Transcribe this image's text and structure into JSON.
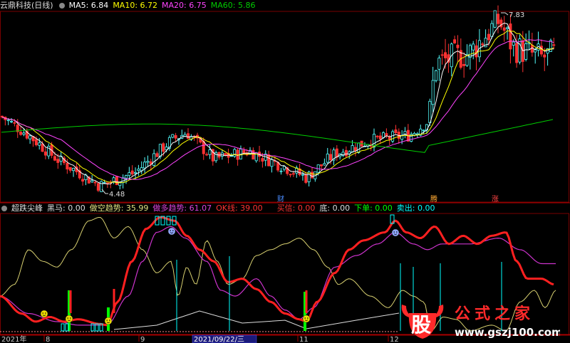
{
  "top_header": {
    "title": "云鼎科技(日线)",
    "ma5": "MA5: 6.84",
    "ma10": "MA10: 6.72",
    "ma20": "MA20: 6.75",
    "ma60": "MA60: 5.86"
  },
  "bottom_header": {
    "name": "超跌尖峰",
    "heima": "黑马: 0.00",
    "kongtrend": "做空趋势: 35.99",
    "duotrend": "做多趋势: 61.07",
    "ok": "OK线: 39.00",
    "buy": "买信: 0.00",
    "di": "底: 0.00",
    "xiadan": "下单: 0.00",
    "sell": "卖出: 0.00"
  },
  "price_labels": {
    "high": "7.83",
    "low": "4.48"
  },
  "event_markers": [
    "财",
    "腾",
    "涨"
  ],
  "x_axis": {
    "labels": [
      "2021年",
      "8",
      "9",
      "2021/09/22/三",
      "11",
      "12"
    ]
  },
  "watermark": {
    "logo_char": "股",
    "brand": "公式之家",
    "url": "www.gszj100.com"
  },
  "colors": {
    "up": "#54ffff",
    "down": "#ff3232",
    "ma5": "#ffffff",
    "ma10": "#ffff00",
    "ma20": "#ff44ff",
    "ma60": "#00cc00",
    "red_line": "#ff2020",
    "violet_line": "#cc33cc",
    "khaki_line": "#d8d070",
    "cyan_bar": "#00ffff",
    "green_bar": "#00ff00",
    "base_line": "#ff8888"
  },
  "chart_data": {
    "type": "line",
    "title": "云鼎科技(日线)",
    "subtitle": "超跌尖峰",
    "price_series": {
      "ma_values": {
        "MA5": 6.84,
        "MA10": 6.72,
        "MA20": 6.75,
        "MA60": 5.86
      },
      "high": 7.83,
      "low": 4.48
    },
    "indicator_values": {
      "黑马": 0.0,
      "做空趋势": 35.99,
      "做多趋势": 61.07,
      "OK线": 39.0,
      "买信": 0.0,
      "底": 0.0,
      "下单": 0.0,
      "卖出": 0.0
    },
    "x_labels": [
      "2021年",
      "8",
      "9",
      "2021/09/22/三",
      "11",
      "12"
    ]
  }
}
